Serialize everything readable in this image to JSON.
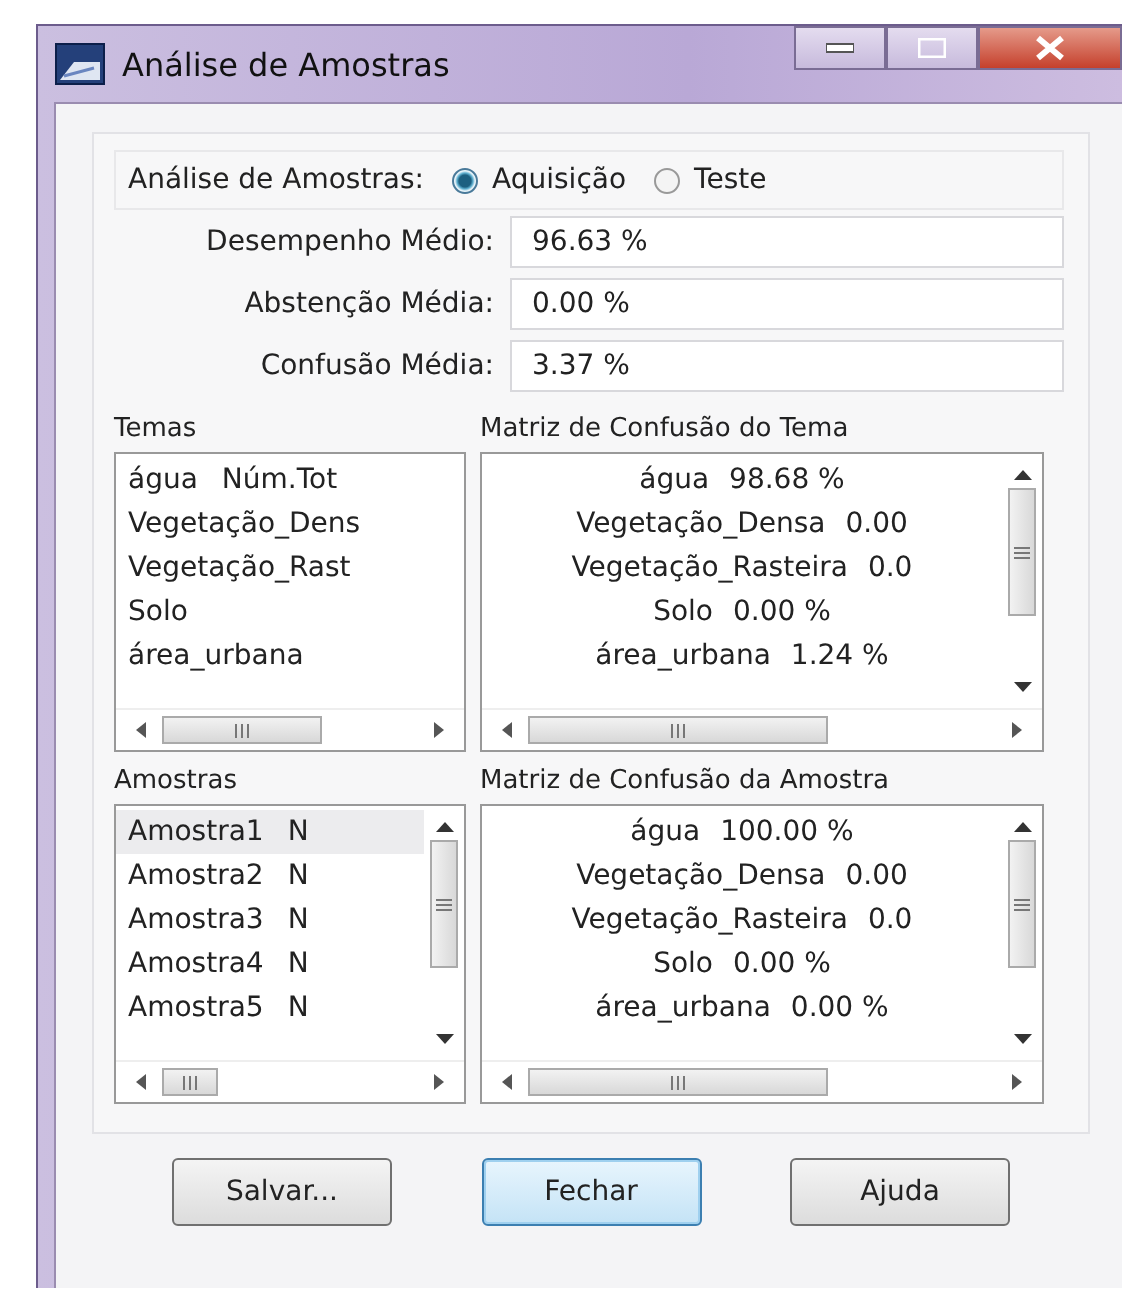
{
  "window": {
    "title": "Análise de Amostras"
  },
  "mode": {
    "label": "Análise de Amostras:",
    "options": [
      {
        "label": "Aquisição",
        "selected": true
      },
      {
        "label": "Teste",
        "selected": false
      }
    ]
  },
  "fields": [
    {
      "label": "Desempenho Médio:",
      "value": "96.63 %"
    },
    {
      "label": "Abstenção Média:",
      "value": "0.00 %"
    },
    {
      "label": "Confusão Média:",
      "value": "3.37 %"
    }
  ],
  "panels": [
    {
      "title": "Temas",
      "kind": "list",
      "vscroll": false,
      "items": [
        {
          "label": "água",
          "extra": "Núm.Tot",
          "selected": false
        },
        {
          "label": "Vegetação_Dens",
          "selected": false
        },
        {
          "label": "Vegetação_Rast",
          "selected": false
        },
        {
          "label": "Solo",
          "selected": false
        },
        {
          "label": "área_urbana",
          "selected": false
        }
      ]
    },
    {
      "title": "Matriz de Confusão do Tema",
      "kind": "matrix",
      "vscroll": true,
      "items": [
        {
          "label": "água",
          "value": "98.68 %"
        },
        {
          "label": "Vegetação_Densa",
          "value": "0.00"
        },
        {
          "label": "Vegetação_Rasteira",
          "value": "0.0"
        },
        {
          "label": "Solo",
          "value": "0.00 %"
        },
        {
          "label": "área_urbana",
          "value": "1.24 %"
        }
      ]
    },
    {
      "title": "Amostras",
      "kind": "list",
      "vscroll": true,
      "items": [
        {
          "label": "Amostra1",
          "extra": "N",
          "selected": true
        },
        {
          "label": "Amostra2",
          "extra": "N",
          "selected": false
        },
        {
          "label": "Amostra3",
          "extra": "N",
          "selected": false
        },
        {
          "label": "Amostra4",
          "extra": "N",
          "selected": false
        },
        {
          "label": "Amostra5",
          "extra": "N",
          "selected": false
        }
      ]
    },
    {
      "title": "Matriz de Confusão da Amostra",
      "kind": "matrix",
      "vscroll": true,
      "items": [
        {
          "label": "água",
          "value": "100.00 %"
        },
        {
          "label": "Vegetação_Densa",
          "value": "0.00"
        },
        {
          "label": "Vegetação_Rasteira",
          "value": "0.0"
        },
        {
          "label": "Solo",
          "value": "0.00 %"
        },
        {
          "label": "área_urbana",
          "value": "0.00 %"
        }
      ]
    }
  ],
  "buttons": [
    {
      "label": "Salvar...",
      "default": false
    },
    {
      "label": "Fechar",
      "default": true
    },
    {
      "label": "Ajuda",
      "default": false
    }
  ]
}
